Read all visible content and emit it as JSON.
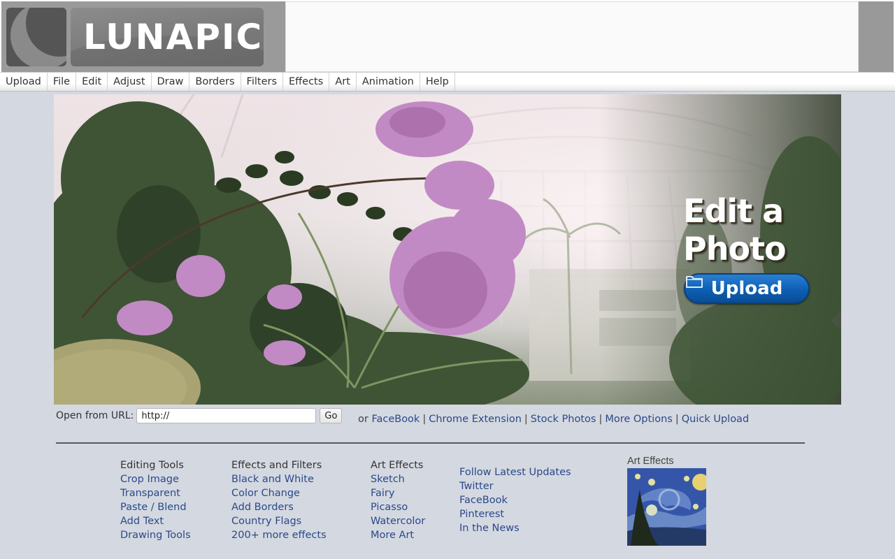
{
  "header": {
    "logo_text": "LUNAPIC"
  },
  "menu": {
    "items": [
      "Upload",
      "File",
      "Edit",
      "Adjust",
      "Draw",
      "Borders",
      "Filters",
      "Effects",
      "Art",
      "Animation",
      "Help"
    ]
  },
  "hero": {
    "title_line1": "Edit a",
    "title_line2": "Photo",
    "upload_label": "Upload",
    "upload_icon": "folder-icon",
    "upload_color": "#0d5fb4"
  },
  "url_row": {
    "label": "Open from URL:",
    "input_value": "http://",
    "go_label": "Go"
  },
  "links_row": {
    "prefix": "or",
    "links": [
      "FaceBook",
      "Chrome Extension",
      "Stock Photos",
      "More Options",
      "Quick Upload"
    ]
  },
  "footer": {
    "columns": [
      {
        "heading": "Editing Tools",
        "links": [
          "Crop Image",
          "Transparent",
          "Paste / Blend",
          "Add Text",
          "Drawing Tools"
        ]
      },
      {
        "heading": "Effects and Filters",
        "links": [
          "Black and White",
          "Color Change",
          "Add Borders",
          "Country Flags",
          "200+ more effects"
        ]
      },
      {
        "heading": "Art Effects",
        "links": [
          "Sketch",
          "Fairy",
          "Picasso",
          "Watercolor",
          "More Art"
        ]
      },
      {
        "heading": "",
        "links": [
          "Follow Latest Updates",
          "Twitter",
          "FaceBook",
          "Pinterest",
          "In the News"
        ]
      }
    ],
    "art_box": {
      "title": "Art Effects",
      "thumbnail": "starry-night-thumbnail"
    }
  },
  "colors": {
    "page_bg": "#d4d8e0",
    "link": "#2a4a8a",
    "header_gray": "#9a9a9a"
  }
}
